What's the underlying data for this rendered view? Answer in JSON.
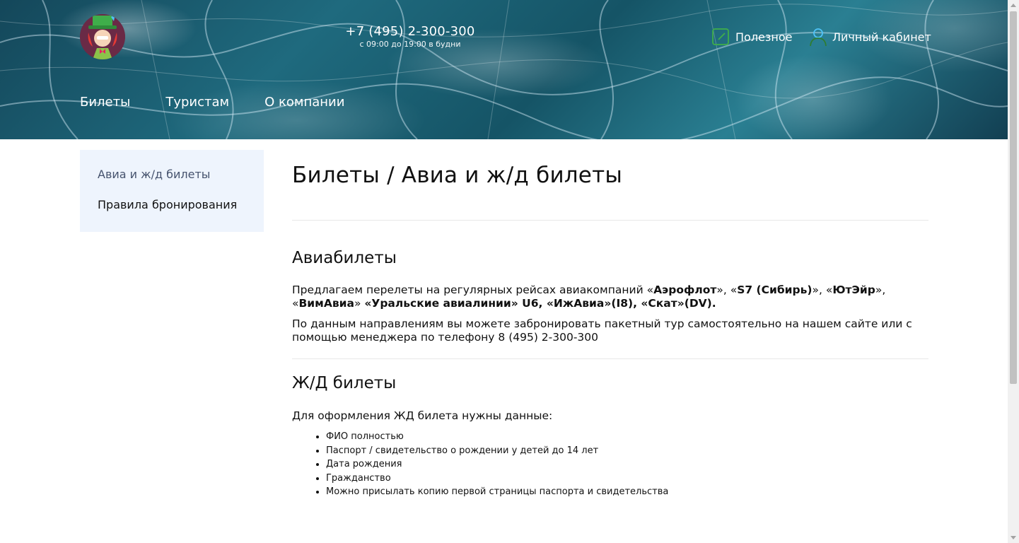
{
  "header": {
    "phone": "+7 (495) 2-300-300",
    "hours": "с 09:00 до 19:00 в будни",
    "useful_label": "Полезное",
    "cabinet_label": "Личный кабинет",
    "nav": [
      {
        "label": "Билеты"
      },
      {
        "label": "Туристам"
      },
      {
        "label": "О компании"
      }
    ]
  },
  "sidebar": {
    "items": [
      {
        "label": "Авиа и ж/д билеты",
        "active": true
      },
      {
        "label": "Правила бронирования",
        "active": false
      }
    ]
  },
  "content": {
    "title": "Билеты / Авиа и ж/д билеты",
    "avia": {
      "heading": "Авиабилеты",
      "p1_prefix": "Предлагаем перелеты на регулярных рейсах авиакомпаний «",
      "airline1": "Аэрофлот",
      "sep1": "», «",
      "airline2": "S7 (Сибирь)",
      "sep2": "», «",
      "airline3": "ЮтЭйр",
      "sep3": "», «",
      "airline4": "ВимАвиа",
      "sep4": "» ",
      "airline_rest": "«Уральские авиалинии» U6, «ИжАвиа»(I8), «Скат»(DV).",
      "p2": "По данным направлениям вы можете забронировать пакетный тур самостоятельно на нашем сайте или с помощью менеджера по телефону 8 (495) 2-300-300"
    },
    "rail": {
      "heading": "Ж/Д билеты",
      "intro": "Для оформления ЖД билета нужны данные:",
      "items": [
        "ФИО полностью",
        "Паспорт / свидетельство о рождении у детей до 14 лет",
        "Дата рождения",
        "Гражданство",
        "Можно присылать копию первой страницы паспорта и свидетельства"
      ]
    }
  },
  "colors": {
    "sidebar_bg": "#eef4fd",
    "active_link": "#46536e",
    "header_water": "#1f6a7e"
  }
}
